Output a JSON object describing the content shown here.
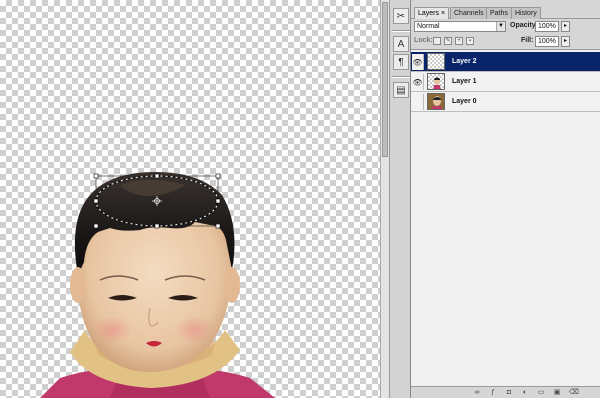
{
  "canvas": {
    "icon": "doll-figure-photo",
    "selection": "elliptical-marquee-transform"
  },
  "tools": [
    {
      "icon": "tool-presets-icon",
      "glyph": "✂"
    },
    {
      "icon": "character-text-icon",
      "glyph": "A"
    },
    {
      "icon": "paragraph-icon",
      "glyph": "¶"
    },
    {
      "icon": "layer-comps-icon",
      "glyph": "▤"
    }
  ],
  "panel": {
    "tabs": [
      {
        "label": "Layers ×",
        "active": true
      },
      {
        "label": "Channels",
        "active": false
      },
      {
        "label": "Paths",
        "active": false
      },
      {
        "label": "History",
        "active": false
      }
    ],
    "blend_mode": "Normal",
    "opacity_label": "Opacity:",
    "opacity_value": "100%",
    "lock_label": "Lock:",
    "fill_label": "Fill:",
    "fill_value": "100%",
    "layers": [
      {
        "name": "Layer 2",
        "visible": true,
        "selected": true,
        "thumb": "transparent-thumbnail"
      },
      {
        "name": "Layer 1",
        "visible": true,
        "selected": false,
        "thumb": "doll-thumbnail-small"
      },
      {
        "name": "Layer 0",
        "visible": false,
        "selected": false,
        "thumb": "doll-photo-thumbnail"
      }
    ],
    "footer_icons": [
      "link-layers-icon",
      "layer-style-icon",
      "add-mask-icon",
      "adjustment-layer-icon",
      "new-group-icon",
      "new-layer-icon",
      "delete-layer-icon"
    ]
  },
  "colors": {
    "selection": "#0a246a",
    "panel_bg": "#d6d6d6"
  }
}
